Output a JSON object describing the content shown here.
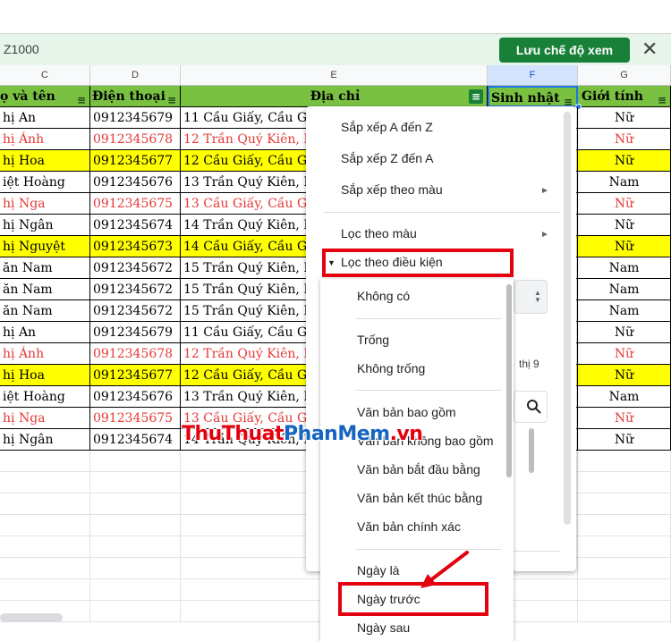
{
  "toolbar": {
    "range_text": "Z1000",
    "save_view_label": "Lưu chế độ xem",
    "close_symbol": "✕"
  },
  "columns": [
    "C",
    "D",
    "E",
    "F",
    "G"
  ],
  "table": {
    "headers": {
      "name": "ọ và tên",
      "phone": "Điện thoại",
      "address": "Địa chỉ",
      "birthday": "Sinh nhật",
      "gender": "Giới tính"
    },
    "rows": [
      {
        "name": "hị An",
        "phone": "0912345679",
        "address": "11 Cầu Giấy, Cầu Giấ",
        "gender": "Nữ",
        "style": "normal"
      },
      {
        "name": "hị Ánh",
        "phone": "0912345678",
        "address": "12 Trần Quý Kiên, D",
        "gender": "Nữ",
        "style": "red"
      },
      {
        "name": "hị Hoa",
        "phone": "0912345677",
        "address": "12 Cầu Giấy, Cầu Giấ",
        "gender": "Nữ",
        "style": "yellow"
      },
      {
        "name": "iệt Hoàng",
        "phone": "0912345676",
        "address": "13 Trần Quý Kiên, D",
        "gender": "Nam",
        "style": "normal"
      },
      {
        "name": "hị Nga",
        "phone": "0912345675",
        "address": "13 Cầu Giấy, Cầu Giấ",
        "gender": "Nữ",
        "style": "red"
      },
      {
        "name": "hị Ngân",
        "phone": "0912345674",
        "address": "14 Trần Quý Kiên, D",
        "gender": "Nữ",
        "style": "normal"
      },
      {
        "name": "hị Nguyệt",
        "phone": "0912345673",
        "address": "14 Cầu Giấy, Cầu Giấ",
        "gender": "Nữ",
        "style": "yellow"
      },
      {
        "name": "ăn Nam",
        "phone": "0912345672",
        "address": "15 Trần Quý Kiên, D",
        "gender": "Nam",
        "style": "normal"
      },
      {
        "name": "ăn Nam",
        "phone": "0912345672",
        "address": "15 Trần Quý Kiên, D",
        "gender": "Nam",
        "style": "normal"
      },
      {
        "name": "ăn Nam",
        "phone": "0912345672",
        "address": "15 Trần Quý Kiên, D",
        "gender": "Nam",
        "style": "normal"
      },
      {
        "name": "hị An",
        "phone": "0912345679",
        "address": "11 Cầu Giấy, Cầu Giấ",
        "gender": "Nữ",
        "style": "normal"
      },
      {
        "name": "hị Ánh",
        "phone": "0912345678",
        "address": "12 Trần Quý Kiên, D",
        "gender": "Nữ",
        "style": "red"
      },
      {
        "name": "hị Hoa",
        "phone": "0912345677",
        "address": "12 Cầu Giấy, Cầu Giấ",
        "gender": "Nữ",
        "style": "yellow"
      },
      {
        "name": "iệt Hoàng",
        "phone": "0912345676",
        "address": "13 Trần Quý Kiên, D",
        "gender": "Nam",
        "style": "normal"
      },
      {
        "name": "hị Nga",
        "phone": "0912345675",
        "address": "13 Cầu Giấy, Cầu Giấ",
        "gender": "Nữ",
        "style": "red"
      },
      {
        "name": "hị Ngân",
        "phone": "0912345674",
        "address": "14 Trần Quý Kiên, D",
        "gender": "Nữ",
        "style": "normal"
      }
    ]
  },
  "filter_menu": {
    "sort_az": "Sắp xếp A đến Z",
    "sort_za": "Sắp xếp Z đến A",
    "sort_color": "Sắp xếp theo màu",
    "filter_color": "Lọc theo màu",
    "filter_condition": "Lọc theo điều kiện",
    "value_partial_1": "thị 9"
  },
  "condition_list": {
    "items": [
      "Không có",
      "Trống",
      "Không trống",
      "Văn bản bao gồm",
      "Văn bản không bao gồm",
      "Văn bản bắt đầu bằng",
      "Văn bản kết thúc bằng",
      "Văn bản chính xác",
      "Ngày là",
      "Ngày trước",
      "Ngày sau"
    ],
    "highlighted": "Ngày trước"
  },
  "watermark": {
    "part1": "ThuThuat",
    "part2": "PhanMem",
    "part3": ".vn"
  },
  "colors": {
    "header_green": "#7ac142",
    "highlight_yellow": "#ffff00",
    "text_red": "#e53935",
    "brand_green": "#188038",
    "callout_red": "#e3000f"
  }
}
